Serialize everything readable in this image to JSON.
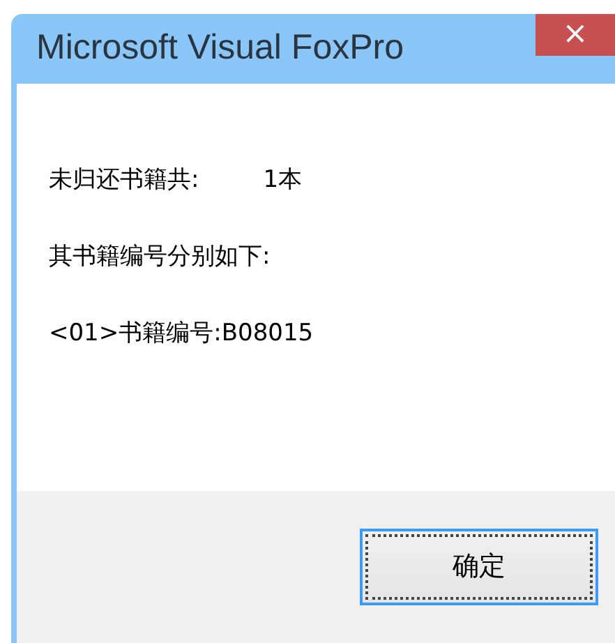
{
  "window": {
    "title": "Microsoft Visual FoxPro",
    "close": "×"
  },
  "lines": [
    {
      "label": "未归还书籍共:",
      "value": "1本"
    },
    {
      "label": "其书籍编号分别如下:"
    },
    {
      "label": "<01>书籍编号:B08015"
    }
  ],
  "button": {
    "label": "确定",
    "focused": true
  }
}
